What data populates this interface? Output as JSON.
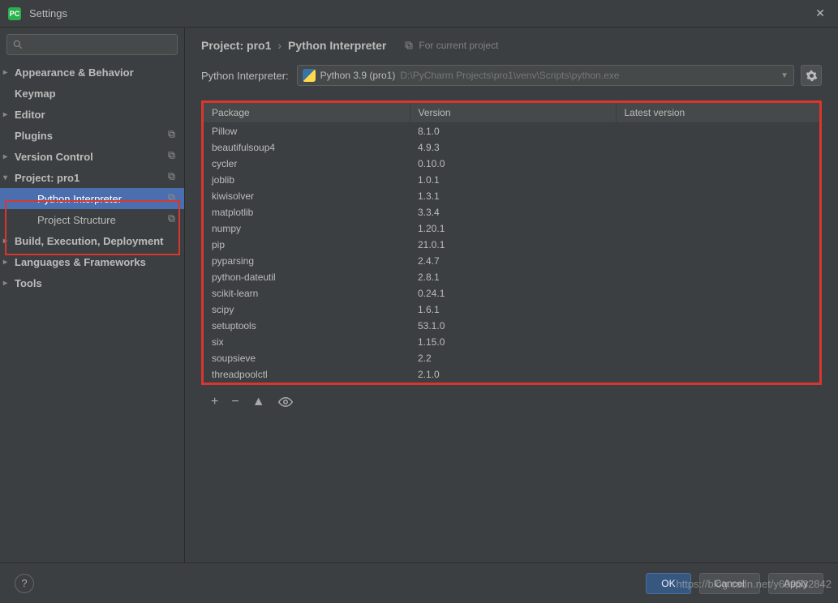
{
  "window": {
    "title": "Settings"
  },
  "search": {
    "placeholder": ""
  },
  "sidebar": {
    "items": [
      {
        "label": "Appearance & Behavior",
        "chevron": ">"
      },
      {
        "label": "Keymap"
      },
      {
        "label": "Editor",
        "chevron": ">"
      },
      {
        "label": "Plugins",
        "suffix": true
      },
      {
        "label": "Version Control",
        "chevron": ">",
        "suffix": true
      },
      {
        "label": "Project: pro1",
        "chevron": "v",
        "suffix": true
      },
      {
        "label": "Python Interpreter",
        "child": true,
        "selected": true,
        "suffix": true
      },
      {
        "label": "Project Structure",
        "child": true,
        "suffix": true
      },
      {
        "label": "Build, Execution, Deployment",
        "chevron": ">"
      },
      {
        "label": "Languages & Frameworks",
        "chevron": ">"
      },
      {
        "label": "Tools",
        "chevron": ">"
      }
    ]
  },
  "breadcrumb": {
    "part1": "Project: pro1",
    "part2": "Python Interpreter",
    "for_project": "For current project"
  },
  "interpreter": {
    "label": "Python Interpreter:",
    "name": "Python 3.9 (pro1)",
    "path": "D:\\PyCharm Projects\\pro1\\venv\\Scripts\\python.exe"
  },
  "packages": {
    "headers": [
      "Package",
      "Version",
      "Latest version"
    ],
    "rows": [
      {
        "name": "Pillow",
        "version": "8.1.0",
        "latest": ""
      },
      {
        "name": "beautifulsoup4",
        "version": "4.9.3",
        "latest": ""
      },
      {
        "name": "cycler",
        "version": "0.10.0",
        "latest": ""
      },
      {
        "name": "joblib",
        "version": "1.0.1",
        "latest": ""
      },
      {
        "name": "kiwisolver",
        "version": "1.3.1",
        "latest": ""
      },
      {
        "name": "matplotlib",
        "version": "3.3.4",
        "latest": ""
      },
      {
        "name": "numpy",
        "version": "1.20.1",
        "latest": ""
      },
      {
        "name": "pip",
        "version": "21.0.1",
        "latest": ""
      },
      {
        "name": "pyparsing",
        "version": "2.4.7",
        "latest": ""
      },
      {
        "name": "python-dateutil",
        "version": "2.8.1",
        "latest": ""
      },
      {
        "name": "scikit-learn",
        "version": "0.24.1",
        "latest": ""
      },
      {
        "name": "scipy",
        "version": "1.6.1",
        "latest": ""
      },
      {
        "name": "setuptools",
        "version": "53.1.0",
        "latest": ""
      },
      {
        "name": "six",
        "version": "1.15.0",
        "latest": ""
      },
      {
        "name": "soupsieve",
        "version": "2.2",
        "latest": ""
      },
      {
        "name": "threadpoolctl",
        "version": "2.1.0",
        "latest": ""
      }
    ]
  },
  "footer": {
    "ok": "OK",
    "cancel": "Cancel",
    "apply": "Apply"
  },
  "watermark": "https://blog.csdn.net/y609532842"
}
